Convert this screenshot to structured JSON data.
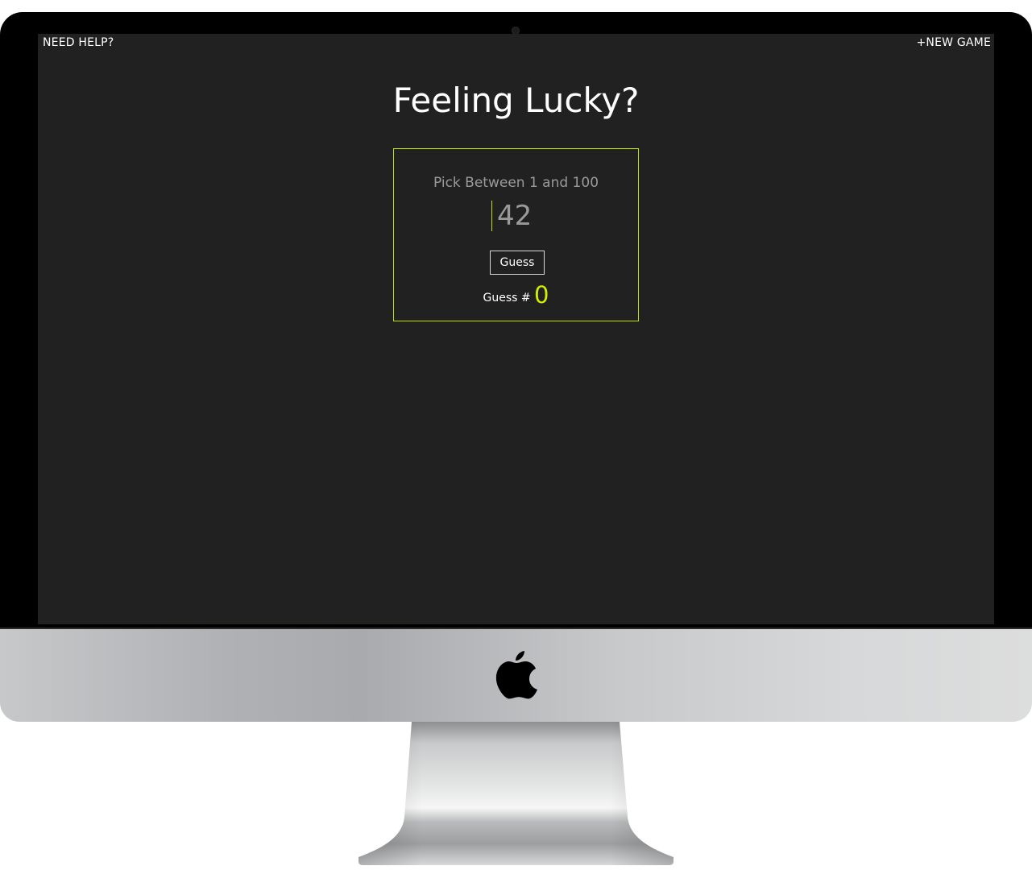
{
  "nav": {
    "help_label": "NEED HELP?",
    "new_game_label": "+NEW GAME"
  },
  "main": {
    "title": "Feeling Lucky?"
  },
  "game": {
    "prompt": "Pick Between 1 and 100",
    "input_value": "42",
    "guess_button_label": "Guess",
    "count_label": "Guess #",
    "count_value": "0"
  },
  "colors": {
    "screen_background": "#212121",
    "accent": "#c4df00",
    "counter": "#d4ee00"
  },
  "icons": {
    "brand_logo": "apple-logo-icon"
  }
}
